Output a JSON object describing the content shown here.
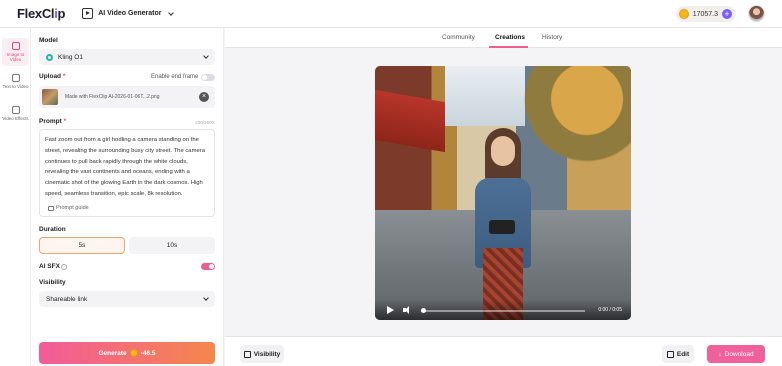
{
  "header": {
    "logo_main": "FlexCl",
    "logo_accent": "i",
    "logo_end": "p",
    "tool_name": "AI Video Generator",
    "credits": "17057.3"
  },
  "rail": [
    {
      "label": "Image to Video",
      "icon": "image-video-icon",
      "active": true
    },
    {
      "label": "Text to Video",
      "icon": "text-video-icon",
      "active": false
    },
    {
      "label": "Video Effects",
      "icon": "effects-icon",
      "active": false
    }
  ],
  "panel": {
    "model_label": "Model",
    "model_value": "Kling O1",
    "upload_label": "Upload",
    "end_frame_label": "Enable end frame",
    "upload_filename": "Made with FlexClip AI-2026-01-06T...2.png",
    "prompt_label": "Prompt",
    "prompt_counter": "200/2500",
    "prompt_text": "Fast zoom out from a girl hodling a camera standing on the street, revealing the surrounding busy city street. The camera continues to pull back rapidly through the white clouds, revealing the vast continents and oceans, ending with a cinematic shot of the glowing Earth in the dark cosmos. High speed, seamless transition, epic scale, 8k resolution.",
    "prompt_guide": "Prompt guide",
    "duration_label": "Duration",
    "duration_options": [
      "5s",
      "10s"
    ],
    "duration_selected": "5s",
    "sfx_label": "AI SFX",
    "visibility_label": "Visibility",
    "visibility_value": "Shareable link",
    "generate_label": "Generate",
    "generate_cost": "-46.5"
  },
  "main": {
    "tabs": [
      "Community",
      "Creations",
      "History"
    ],
    "active_tab": "Creations",
    "video_time": "0:00 / 0:05",
    "visibility_button": "Visibility",
    "edit_button": "Edit",
    "download_button": "Download"
  },
  "colors": {
    "accent_pink": "#ee5d8e",
    "generate_gradient_start": "#f25b9a",
    "generate_gradient_end": "#f6864c",
    "brand_purple": "#7b5cff"
  }
}
